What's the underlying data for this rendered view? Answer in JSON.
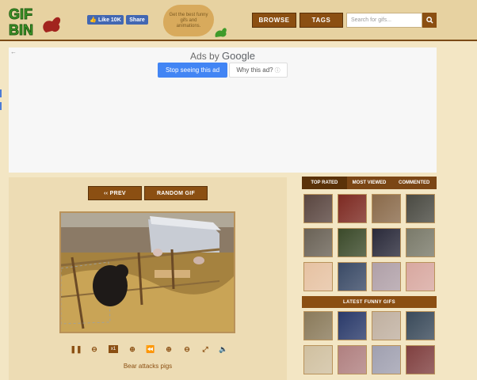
{
  "header": {
    "fb_like_label": "Like 10K",
    "fb_share_label": "Share",
    "tagline": "Get the best funny gifs and animations.",
    "nav": [
      {
        "label": "BROWSE"
      },
      {
        "label": "TAGS"
      }
    ],
    "search_placeholder": "Search for gifs..."
  },
  "ad": {
    "ads_by": "Ads by",
    "google": "Google",
    "stop_label": "Stop seeing this ad",
    "why_label": "Why this ad?"
  },
  "content": {
    "prev_label": "‹‹ PREV",
    "random_label": "RANDOM GIF",
    "speed_label": "x1",
    "caption": "Bear attacks pigs"
  },
  "sidebar": {
    "tabs": [
      {
        "label": "TOP RATED",
        "active": true
      },
      {
        "label": "MOST VIEWED",
        "active": false
      },
      {
        "label": "COMMENTED",
        "active": false
      }
    ],
    "latest_heading": "LATEST FUNNY GIFS",
    "top_thumbs": [
      {
        "color": "#5a4640"
      },
      {
        "color": "#7d2a22"
      },
      {
        "color": "#8a6a4a"
      },
      {
        "color": "#4a4a42"
      },
      {
        "color": "#6a6256"
      },
      {
        "color": "#3b4a2a"
      },
      {
        "color": "#2a2a3a"
      },
      {
        "color": "#7a7a6a"
      },
      {
        "color": "#e6c2a2"
      },
      {
        "color": "#3a4a66"
      },
      {
        "color": "#b0a0a8"
      },
      {
        "color": "#d8a8a0"
      }
    ],
    "latest_thumbs": [
      {
        "color": "#8a7a5a"
      },
      {
        "color": "#2a3a6a"
      },
      {
        "color": "#c0b0a0"
      },
      {
        "color": "#3a4a5a"
      },
      {
        "color": "#d0c0a0"
      },
      {
        "color": "#b08080"
      },
      {
        "color": "#a0a0b0"
      },
      {
        "color": "#804040"
      }
    ]
  }
}
